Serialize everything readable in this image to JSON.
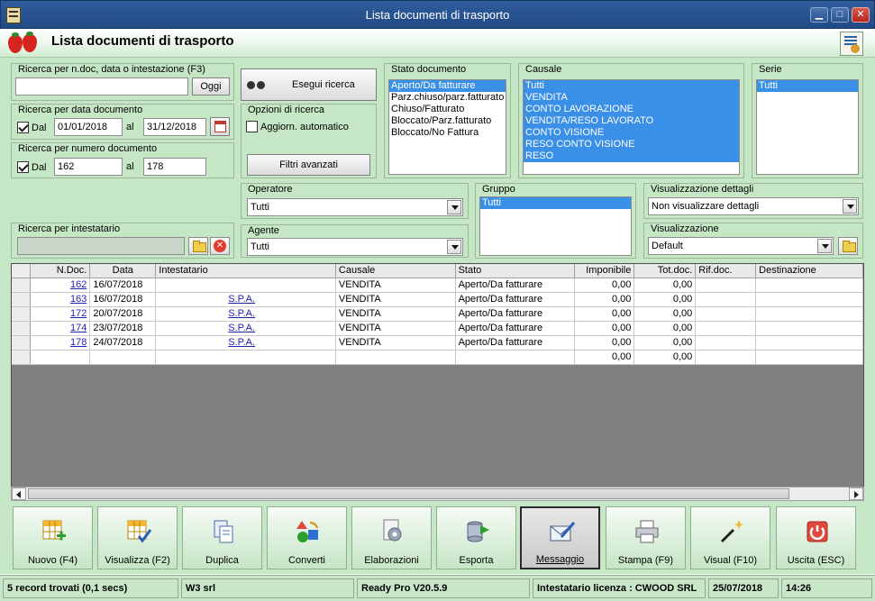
{
  "window": {
    "title": "Lista documenti di trasporto",
    "minimize": "▁",
    "maximize": "□",
    "close": "✕"
  },
  "header": {
    "title": "Lista documenti di trasporto"
  },
  "search_text": {
    "legend": "Ricerca per n.doc, data o intestazione (F3)",
    "value": "",
    "oggi_button": "Oggi"
  },
  "search_button": "Esegui ricerca",
  "date_search": {
    "legend": "Ricerca per data documento",
    "dal_label": "Dal",
    "from": "01/01/2018",
    "al_label": "al",
    "to": "31/12/2018"
  },
  "number_search": {
    "legend": "Ricerca per numero documento",
    "dal_label": "Dal",
    "from": "162",
    "al_label": "al",
    "to": "178"
  },
  "options": {
    "legend": "Opzioni di ricerca",
    "auto_update": "Aggiorn. automatico",
    "advanced_filters": "Filtri avanzati"
  },
  "stato": {
    "legend": "Stato documento",
    "items": [
      "Aperto/Da fatturare",
      "Parz.chiuso/parz.fatturato",
      "Chiuso/Fatturato",
      "Bloccato/Parz.fatturato",
      "Bloccato/No Fattura"
    ]
  },
  "causale": {
    "legend": "Causale",
    "items": [
      "Tutti",
      "VENDITA",
      "CONTO LAVORAZIONE",
      "VENDITA/RESO LAVORATO",
      "CONTO VISIONE",
      "RESO CONTO VISIONE",
      "RESO"
    ]
  },
  "serie": {
    "legend": "Serie",
    "items": [
      "Tutti"
    ]
  },
  "operatore": {
    "legend": "Operatore",
    "value": "Tutti"
  },
  "agente": {
    "legend": "Agente",
    "value": "Tutti"
  },
  "gruppo": {
    "legend": "Gruppo",
    "items": [
      "Tutti"
    ]
  },
  "dettagli": {
    "legend": "Visualizzazione dettagli",
    "value": "Non visualizzare dettagli"
  },
  "visualizzazione": {
    "legend": "Visualizzazione",
    "value": "Default"
  },
  "intestatario": {
    "legend": "Ricerca per intestatario",
    "value": ""
  },
  "grid": {
    "columns": [
      "N.Doc.",
      "Data",
      "Intestatario",
      "Causale",
      "Stato",
      "Imponibile",
      "Tot.doc.",
      "Rif.doc.",
      "Destinazione"
    ],
    "rows": [
      {
        "ndoc": "162",
        "data": "16/07/2018",
        "intestatario": "",
        "causale": "VENDITA",
        "stato": "Aperto/Da fatturare",
        "imponibile": "0,00",
        "totdoc": "0,00",
        "rifdoc": "",
        "destinazione": ""
      },
      {
        "ndoc": "163",
        "data": "16/07/2018",
        "intestatario": "S.P.A.",
        "causale": "VENDITA",
        "stato": "Aperto/Da fatturare",
        "imponibile": "0,00",
        "totdoc": "0,00",
        "rifdoc": "",
        "destinazione": ""
      },
      {
        "ndoc": "172",
        "data": "20/07/2018",
        "intestatario": "S.P.A.",
        "causale": "VENDITA",
        "stato": "Aperto/Da fatturare",
        "imponibile": "0,00",
        "totdoc": "0,00",
        "rifdoc": "",
        "destinazione": ""
      },
      {
        "ndoc": "174",
        "data": "23/07/2018",
        "intestatario": "S.P.A.",
        "causale": "VENDITA",
        "stato": "Aperto/Da fatturare",
        "imponibile": "0,00",
        "totdoc": "0,00",
        "rifdoc": "",
        "destinazione": ""
      },
      {
        "ndoc": "178",
        "data": "24/07/2018",
        "intestatario": "S.P.A.",
        "causale": "VENDITA",
        "stato": "Aperto/Da fatturare",
        "imponibile": "0,00",
        "totdoc": "0,00",
        "rifdoc": "",
        "destinazione": ""
      }
    ],
    "totals": {
      "imponibile": "0,00",
      "totdoc": "0,00"
    }
  },
  "toolbar": [
    {
      "key": "nuovo",
      "label": "Nuovo (F4)",
      "icon": "grid-add-icon"
    },
    {
      "key": "visualizza",
      "label": "Visualizza (F2)",
      "icon": "grid-check-icon"
    },
    {
      "key": "duplica",
      "label": "Duplica",
      "icon": "copy-icon"
    },
    {
      "key": "converti",
      "label": "Converti",
      "icon": "convert-icon"
    },
    {
      "key": "elaborazioni",
      "label": "Elaborazioni",
      "icon": "gear-document-icon"
    },
    {
      "key": "esporta",
      "label": "Esporta",
      "icon": "database-export-icon"
    },
    {
      "key": "messaggio",
      "label": "Messaggio",
      "icon": "envelope-pen-icon"
    },
    {
      "key": "stampa",
      "label": "Stampa (F9)",
      "icon": "printer-icon"
    },
    {
      "key": "visual",
      "label": "Visual (F10)",
      "icon": "magic-wand-icon"
    },
    {
      "key": "uscita",
      "label": "Uscita (ESC)",
      "icon": "power-icon"
    }
  ],
  "statusbar": {
    "records": "5 record trovati (0,1 secs)",
    "company": "W3 srl",
    "version": "Ready Pro V20.5.9",
    "license": "Intestatario licenza : CWOOD SRL",
    "date": "25/07/2018",
    "time": "14:26"
  }
}
